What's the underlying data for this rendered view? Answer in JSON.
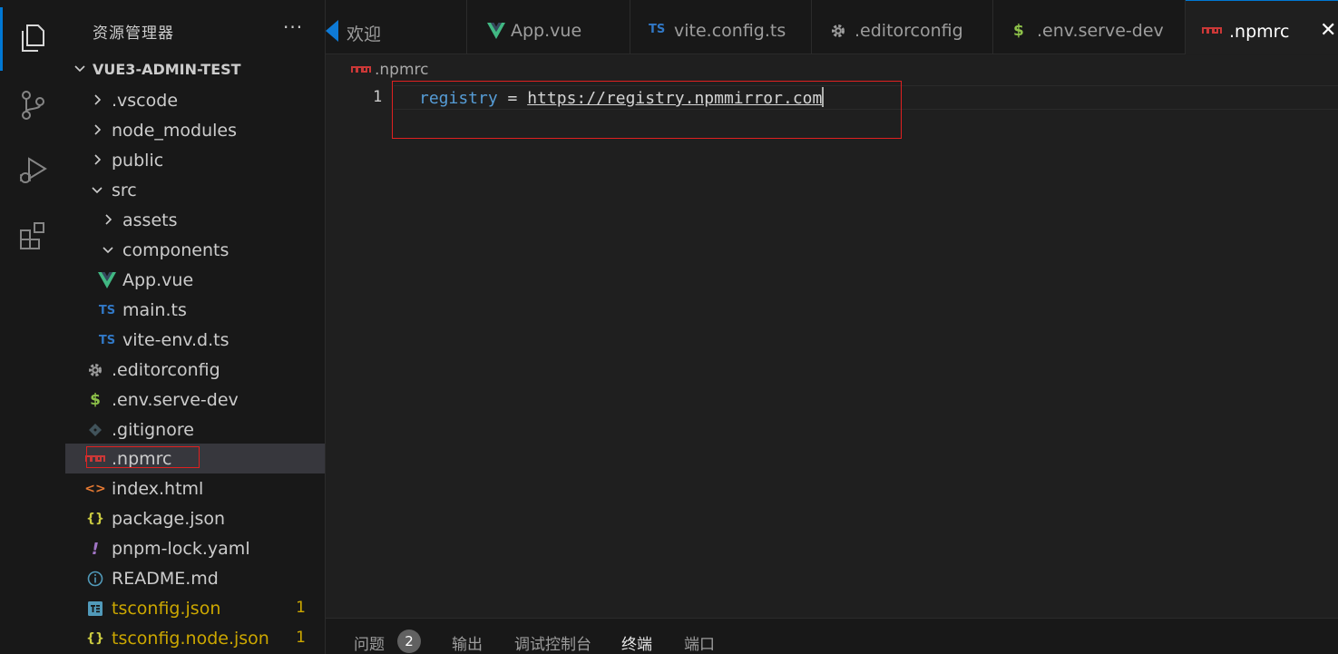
{
  "sidebar": {
    "title": "资源管理器",
    "more": "···",
    "project": "VUE3-ADMIN-TEST",
    "items": [
      {
        "label": ".vscode",
        "type": "folder-collapsed"
      },
      {
        "label": "node_modules",
        "type": "folder-collapsed"
      },
      {
        "label": "public",
        "type": "folder-collapsed"
      },
      {
        "label": "src",
        "type": "folder-expanded"
      },
      {
        "label": "assets",
        "type": "folder-collapsed"
      },
      {
        "label": "components",
        "type": "folder-expanded"
      },
      {
        "label": "App.vue",
        "type": "vue-file",
        "icon": "vue-icon"
      },
      {
        "label": "main.ts",
        "type": "ts-file",
        "icon_text": "TS"
      },
      {
        "label": "vite-env.d.ts",
        "type": "ts-file",
        "icon_text": "TS"
      },
      {
        "label": ".editorconfig",
        "type": "config-file",
        "icon": "gear-icon"
      },
      {
        "label": ".env.serve-dev",
        "type": "env-file",
        "icon_text": "$"
      },
      {
        "label": ".gitignore",
        "type": "git-file",
        "icon": "git-icon"
      },
      {
        "label": ".npmrc",
        "type": "npm-file",
        "icon": "npm-icon",
        "selected": true
      },
      {
        "label": "index.html",
        "type": "html-file",
        "icon_text": "<>"
      },
      {
        "label": "package.json",
        "type": "json-file",
        "icon_text": "{}"
      },
      {
        "label": "pnpm-lock.yaml",
        "type": "yaml-file",
        "icon_text": "!"
      },
      {
        "label": "README.md",
        "type": "info-file",
        "icon": "info-icon"
      },
      {
        "label": "tsconfig.json",
        "type": "tsconfig-file",
        "badge": "1"
      },
      {
        "label": "tsconfig.node.json",
        "type": "json-file",
        "icon_text": "{}",
        "badge": "1"
      }
    ]
  },
  "tabs": [
    {
      "label": "欢迎",
      "icon": "vscode-icon"
    },
    {
      "label": "App.vue",
      "icon": "vue-icon"
    },
    {
      "label": "vite.config.ts",
      "icon_text": "TS"
    },
    {
      "label": ".editorconfig",
      "icon": "gear-icon"
    },
    {
      "label": ".env.serve-dev",
      "icon_text": "$"
    },
    {
      "label": ".npmrc",
      "icon": "npm-icon",
      "active": true,
      "close": "✕"
    }
  ],
  "editor": {
    "breadcrumb": ".npmrc",
    "line_number": "1",
    "code_key": "registry",
    "code_eq": " = ",
    "code_value": "https://registry.npmmirror.com"
  },
  "panel": {
    "tabs": [
      "问题",
      "输出",
      "调试控制台",
      "终端",
      "端口"
    ],
    "problems_count": "2",
    "active": "终端"
  },
  "colors": {
    "accent": "#0078d4",
    "highlight_box": "#e02020",
    "warning": "#cca700",
    "vue": "#41b883",
    "ts": "#3178c6",
    "npm": "#cb3837"
  }
}
